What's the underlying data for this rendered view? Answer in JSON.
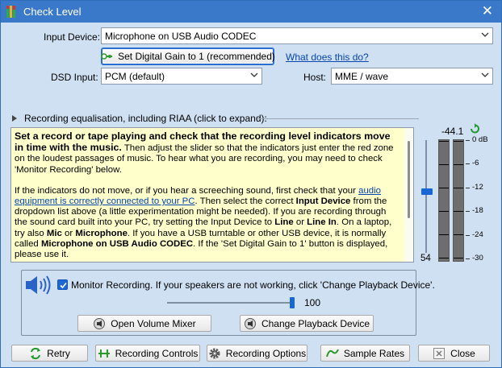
{
  "window": {
    "title": "Check Level"
  },
  "colors": {
    "accent": "#3a79c9",
    "dialog_bg": "#cfe0f3",
    "info_bg": "#ffffcc",
    "link": "#0645ad",
    "slider": "#1766d3"
  },
  "input_device": {
    "label": "Input Device:",
    "value": "Microphone on USB Audio CODEC"
  },
  "gain": {
    "button_label": "Set Digital Gain to 1 (recommended)",
    "link": "What does this do?"
  },
  "dsd": {
    "label": "DSD Input:",
    "value": "PCM (default)"
  },
  "host": {
    "label": "Host:",
    "value": "MME / wave"
  },
  "equalisation": {
    "label": "Recording equalisation, including RIAA (click to expand):"
  },
  "info": {
    "p1_bold": "Set a record or tape playing and check that the recording level indicators move in time with the music.",
    "p1_rest": " Then adjust the slider so that the indicators just enter the red zone on the loudest passages of music.  To hear what you are recording, you may need to check 'Monitor Recording' below.",
    "p2_a": "If the indicators do not move, or if you hear a screeching sound, first check that your ",
    "p2_link": "audio equipment is correctly connected to your PC",
    "p2_b": ".  Then select the correct ",
    "p2_input_device": "Input Device",
    "p2_c": " from the dropdown list above (a little experimentation might be needed).  If you are recording through the sound card built into your PC, try setting the Input Device to ",
    "p2_line": "Line",
    "p2_or1": " or ",
    "p2_line_in": "Line In",
    "p2_d": ".  On a laptop, try also ",
    "p2_mic": "Mic",
    "p2_or2": " or ",
    "p2_microphone": "Microphone",
    "p2_e": ".  If you have a USB turntable or other USB device, it is normally called ",
    "p2_usb": "Microphone on USB Audio CODEC",
    "p2_f": ".  If the 'Set Digital Gain to 1' button is displayed, please use it."
  },
  "record_slider": {
    "value": "54",
    "fraction": 0.54
  },
  "meter": {
    "peak": "-44.1",
    "scale": [
      "0 dB",
      "-6",
      "-12",
      "-18",
      "-24",
      "-30"
    ]
  },
  "monitor": {
    "checked": true,
    "label": "Monitor Recording.  If your speakers are not working, click 'Change Playback Device'.",
    "volume": "100",
    "volume_fraction": 1.0
  },
  "buttons": {
    "open_mixer": "Open Volume Mixer",
    "change_playback": "Change Playback Device",
    "retry": "Retry",
    "recording_controls": "Recording Controls",
    "recording_options": "Recording Options",
    "sample_rates": "Sample Rates",
    "close": "Close"
  }
}
